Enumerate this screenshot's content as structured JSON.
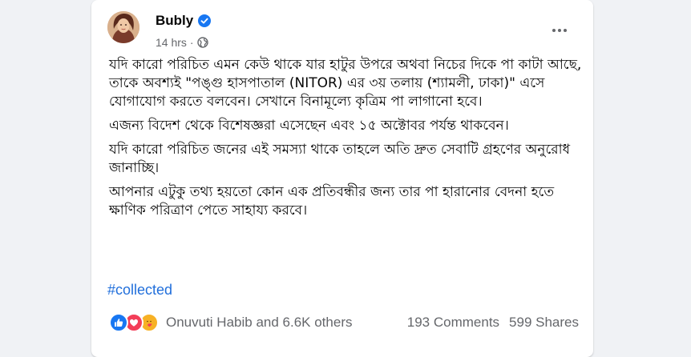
{
  "post": {
    "author": "Bubly",
    "time": "14 hrs",
    "time_separator": "·",
    "paragraphs": [
      "যদি কারো পরিচিত এমন কেউ থাকে যার হাটুর উপরে অথবা নিচের দিকে পা কাটা আছে, তাকে অবশ্যই \"পঙ্গু হাসপাতাল (NITOR) এর ৩য় তলায় (শ্যামলী, ঢাকা)\" এসে যোগাযোগ করতে বলবেন। সেখানে বিনামূল্যে কৃত্রিম পা লাগানো হবে।",
      "এজন্য বিদেশ থেকে বিশেষজ্ঞরা এসেছেন এবং ১৫ অক্টোবর পর্যন্ত থাকবেন।",
      "যদি কারো পরিচিত জনের এই সমস্যা থাকে তাহলে অতি দ্রুত সেবাটি গ্রহণের অনুরোধ জানাচ্ছি।",
      "আপনার এটুকু তথ্য হয়তো কোন এক প্রতিবন্ধীর জন্য তার পা হারানোর বেদনা হতে ক্ষাণিক পরিত্রাণ পেতে সাহায্য করবে।"
    ],
    "hashtag": "#collected"
  },
  "reactions": {
    "types": [
      "like",
      "love",
      "care"
    ],
    "summary": "Onuvuti Habib and 6.6K others",
    "comments": "193 Comments",
    "shares": "599 Shares"
  },
  "colors": {
    "link": "#216fdb",
    "secondary_text": "#65676b",
    "like": "#1877f2",
    "love": "#f33e58",
    "care": "#f7b125",
    "verified": "#1877f2"
  },
  "icons": {
    "verified": "verified-badge-icon",
    "audience": "globe-icon",
    "more": "more-options-icon"
  }
}
